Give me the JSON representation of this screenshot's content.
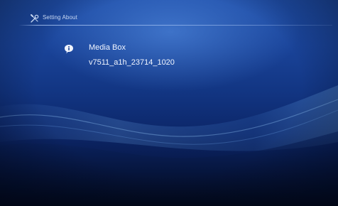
{
  "header": {
    "title": "Setting About",
    "icon": "tools-icon"
  },
  "about": {
    "icon": "info-bubble-icon",
    "device_name": "Media Box",
    "firmware_version": "v7511_a1h_23714_1020"
  },
  "colors": {
    "background_top": "#1f4ea8",
    "background_bottom": "#030a22",
    "text": "#f2f6ff"
  }
}
